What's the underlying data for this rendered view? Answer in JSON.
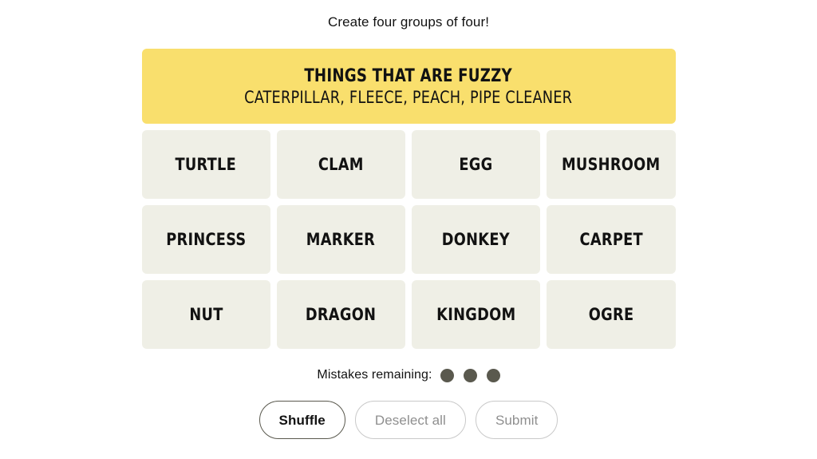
{
  "instruction": "Create four groups of four!",
  "colors": {
    "yellow_group": "#f9df6d",
    "tile_background": "#efefe6",
    "dot": "#5a594e",
    "enabled_border": "#5a594e",
    "disabled_border": "#c9c9c9",
    "disabled_text": "#8f8f8f",
    "page_background": "#ffffff"
  },
  "solved_groups": [
    {
      "title": "THINGS THAT ARE FUZZY",
      "members": "CATERPILLAR, FLEECE, PEACH, PIPE CLEANER",
      "color": "#f9df6d",
      "difficulty": "yellow"
    }
  ],
  "grid": {
    "rows": [
      {
        "tiles": [
          {
            "label": "TURTLE"
          },
          {
            "label": "CLAM"
          },
          {
            "label": "EGG"
          },
          {
            "label": "MUSHROOM"
          }
        ]
      },
      {
        "tiles": [
          {
            "label": "PRINCESS"
          },
          {
            "label": "MARKER"
          },
          {
            "label": "DONKEY"
          },
          {
            "label": "CARPET"
          }
        ]
      },
      {
        "tiles": [
          {
            "label": "NUT"
          },
          {
            "label": "DRAGON"
          },
          {
            "label": "KINGDOM"
          },
          {
            "label": "OGRE"
          }
        ]
      }
    ]
  },
  "mistakes": {
    "label": "Mistakes remaining:",
    "remaining": 3,
    "dots": [
      1,
      2,
      3
    ]
  },
  "buttons": {
    "shuffle": {
      "label": "Shuffle",
      "state": "enabled"
    },
    "deselect_all": {
      "label": "Deselect all",
      "state": "disabled"
    },
    "submit": {
      "label": "Submit",
      "state": "disabled"
    }
  }
}
